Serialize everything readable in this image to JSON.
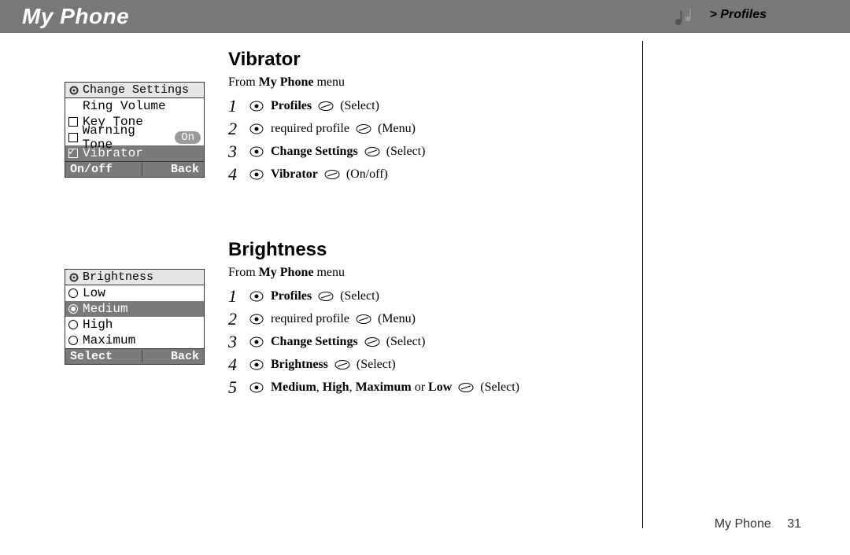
{
  "header": {
    "title": "My Phone",
    "breadcrumb": "> Profiles"
  },
  "phone1": {
    "title": "Change Settings",
    "rows": {
      "r1": "Ring Volume",
      "r2": "Key Tone",
      "r3": "Warning Tone",
      "r3_badge": "On",
      "r4": "Vibrator"
    },
    "soft_left": "On/off",
    "soft_right": "Back"
  },
  "phone2": {
    "title": "Brightness",
    "rows": {
      "r1": "Low",
      "r2": "Medium",
      "r3": "High",
      "r4": "Maximum"
    },
    "soft_left": "Select",
    "soft_right": "Back"
  },
  "section1": {
    "title": "Vibrator",
    "from_a": "From ",
    "from_b": "My Phone",
    "from_c": " menu",
    "steps": {
      "s1_b": "Profiles",
      "s1_t": " (Select)",
      "s2_a": "required profile ",
      "s2_t": " (Menu)",
      "s3_b": "Change Settings",
      "s3_t": " (Select)",
      "s4_b": "Vibrator",
      "s4_t": " (On/off)"
    }
  },
  "section2": {
    "title": "Brightness",
    "from_a": "From ",
    "from_b": "My Phone",
    "from_c": " menu",
    "steps": {
      "s1_b": "Profiles",
      "s1_t": " (Select)",
      "s2_a": "required profile ",
      "s2_t": " (Menu)",
      "s3_b": "Change Settings",
      "s3_t": " (Select)",
      "s4_b": "Brightness",
      "s4_t": " (Select)",
      "s5_b1": "Medium",
      "s5_c1": ", ",
      "s5_b2": "High",
      "s5_c2": ", ",
      "s5_b3": "Maximum",
      "s5_c3": " or ",
      "s5_b4": "Low",
      "s5_t": " (Select)"
    }
  },
  "footer": {
    "section": "My Phone",
    "page": "31"
  }
}
